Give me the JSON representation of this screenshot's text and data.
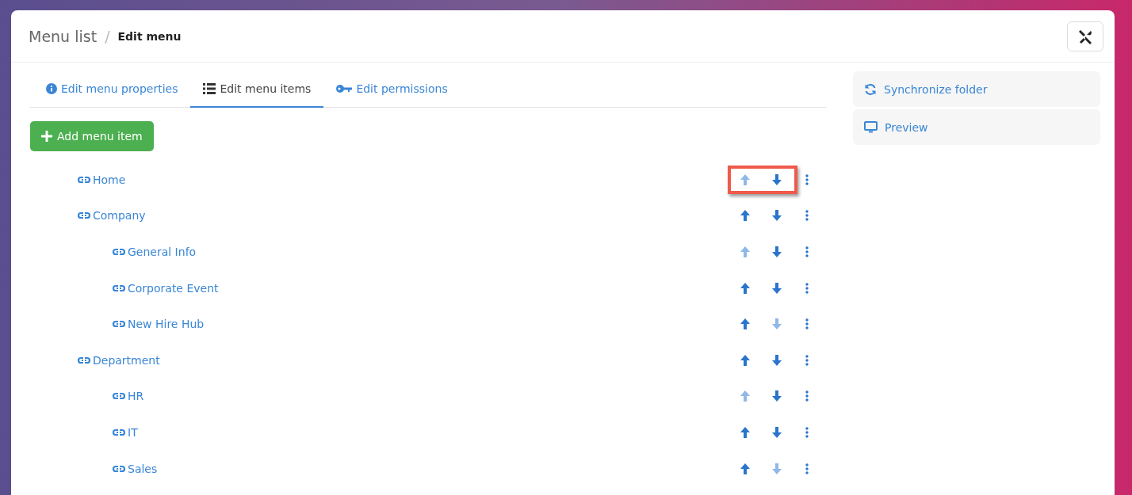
{
  "breadcrumb": {
    "parent": "Menu list",
    "separator": "/",
    "current": "Edit menu"
  },
  "tabs": [
    {
      "label": "Edit menu properties",
      "selected": false
    },
    {
      "label": "Edit menu items",
      "selected": true
    },
    {
      "label": "Edit permissions",
      "selected": false
    }
  ],
  "add_button": "Add menu item",
  "side_actions": [
    {
      "label": "Synchronize folder"
    },
    {
      "label": "Preview"
    }
  ],
  "menu_items": [
    {
      "label": "Home",
      "up_disabled": true,
      "down_disabled": false,
      "highlighted": true
    },
    {
      "label": "Company",
      "up_disabled": false,
      "down_disabled": false,
      "highlighted": false,
      "children": [
        {
          "label": "General Info",
          "up_disabled": true,
          "down_disabled": false,
          "highlighted": false
        },
        {
          "label": "Corporate Event",
          "up_disabled": false,
          "down_disabled": false,
          "highlighted": false
        },
        {
          "label": "New Hire Hub",
          "up_disabled": false,
          "down_disabled": true,
          "highlighted": false
        }
      ]
    },
    {
      "label": "Department",
      "up_disabled": false,
      "down_disabled": false,
      "highlighted": false,
      "children": [
        {
          "label": "HR",
          "up_disabled": true,
          "down_disabled": false,
          "highlighted": false
        },
        {
          "label": "IT",
          "up_disabled": false,
          "down_disabled": false,
          "highlighted": false
        },
        {
          "label": "Sales",
          "up_disabled": false,
          "down_disabled": true,
          "highlighted": false
        }
      ]
    }
  ]
}
